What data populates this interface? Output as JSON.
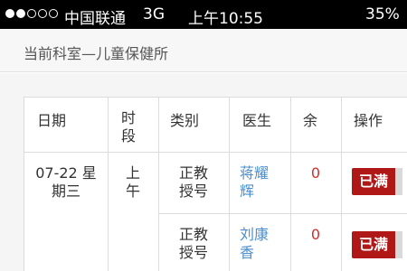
{
  "status_bar": {
    "carrier": "中国联通",
    "network": "3G",
    "time": "上午10:55",
    "battery": "35%"
  },
  "department": {
    "label": "当前科室—儿童保健所"
  },
  "table": {
    "headers": {
      "date": "日期",
      "period_line1": "时",
      "period_line2": "段",
      "type": "类别",
      "doctor": "医生",
      "remaining": "余",
      "action": "操作"
    },
    "rows": [
      {
        "date_line1": "07-22 星",
        "date_line2": "期三",
        "period": "上午",
        "type_line1": "正教",
        "type_line2": "授号",
        "doctor_line1": "蒋耀",
        "doctor_line2": "辉",
        "remaining": "0",
        "action": "已满"
      },
      {
        "type_line1": "正教",
        "type_line2": "授号",
        "doctor_line1": "刘康",
        "doctor_line2": "香",
        "remaining": "0",
        "action": "已满"
      }
    ]
  }
}
